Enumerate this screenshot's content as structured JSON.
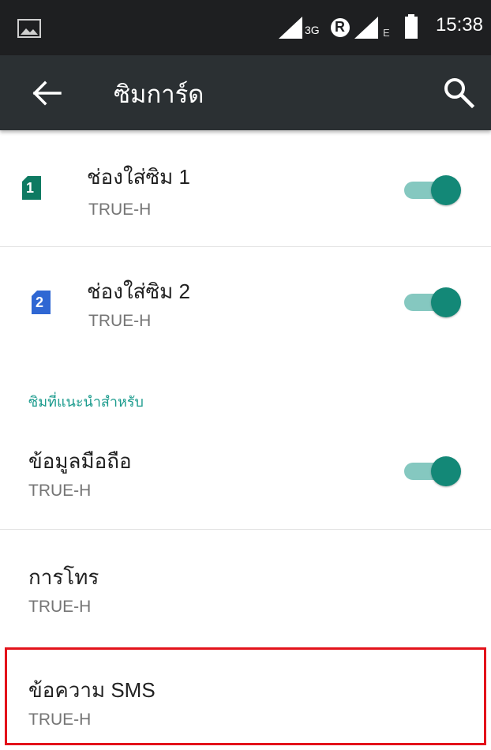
{
  "status_bar": {
    "time": "15:38",
    "network_label": "3G",
    "roaming_badge": "R",
    "data_label": "E",
    "icons": [
      "gallery-icon",
      "signal-icon",
      "roaming-icon",
      "signal-icon",
      "battery-icon"
    ]
  },
  "app_bar": {
    "title": "ซิมการ์ด",
    "back_icon": "back-arrow-icon",
    "search_icon": "search-icon"
  },
  "sim_slots": [
    {
      "title": "ช่องใส่ซิม 1",
      "carrier": "TRUE-H",
      "badge": "1",
      "badge_color": "#0e7a62",
      "enabled": true
    },
    {
      "title": "ช่องใส่ซิม 2",
      "carrier": "TRUE-H",
      "badge": "2",
      "badge_color": "#2f67d3",
      "enabled": true
    }
  ],
  "preferred_section": {
    "header": "ซิมที่แนะนำสำหรับ",
    "items": [
      {
        "title": "ข้อมูลมือถือ",
        "value": "TRUE-H",
        "has_toggle": true,
        "enabled": true
      },
      {
        "title": "การโทร",
        "value": "TRUE-H",
        "has_toggle": false
      },
      {
        "title": "ข้อความ SMS",
        "value": "TRUE-H",
        "has_toggle": false,
        "highlighted": true
      }
    ]
  },
  "colors": {
    "accent": "#138877",
    "toggle_track": "#85c8c0",
    "app_bar": "#2b3033",
    "highlight": "#e3121a"
  }
}
